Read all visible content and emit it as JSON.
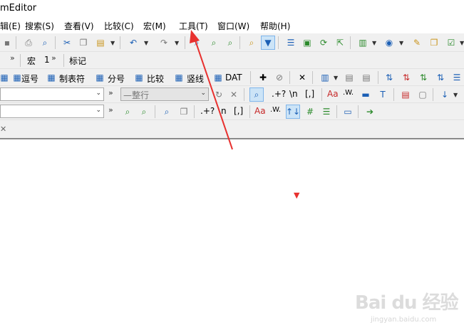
{
  "app": {
    "title": "mEditor"
  },
  "menu": {
    "items": [
      {
        "label": "辑(E)"
      },
      {
        "label": "搜索(S)"
      },
      {
        "label": "查看(V)"
      },
      {
        "label": "比较(C)"
      },
      {
        "label": "宏(M)"
      },
      {
        "label": "工具(T)"
      },
      {
        "label": "窗口(W)"
      },
      {
        "label": "帮助(H)"
      }
    ]
  },
  "toolbar2": {
    "macro_label": "宏",
    "macro_suffix": "1",
    "bookmark_label": "标记"
  },
  "toolbar3": {
    "buttons": [
      {
        "label": "逗号"
      },
      {
        "label": "制表符"
      },
      {
        "label": "分号"
      },
      {
        "label": "比较"
      },
      {
        "label": "竖线"
      },
      {
        "label": "DAT"
      }
    ]
  },
  "toolbar4": {
    "mode_value": "—整行",
    "regex_any": ".+?",
    "newline": "\\n",
    "bracket": "[,]",
    "case_label": "Aa",
    "word_label": ".W."
  },
  "toolbar5": {
    "regex_any": ".+?",
    "newline": "\\n",
    "bracket": "[,]",
    "case_label": "Aa",
    "word_label": ".W.",
    "swap_label": "↑↓"
  },
  "watermark": {
    "brand": "Bai du 经验",
    "url": "jingyan.baidu.com"
  },
  "colors": {
    "toolbar_bg": "#f0f0f0",
    "accent": "#1b5fb5",
    "annotation": "#e8312f"
  }
}
